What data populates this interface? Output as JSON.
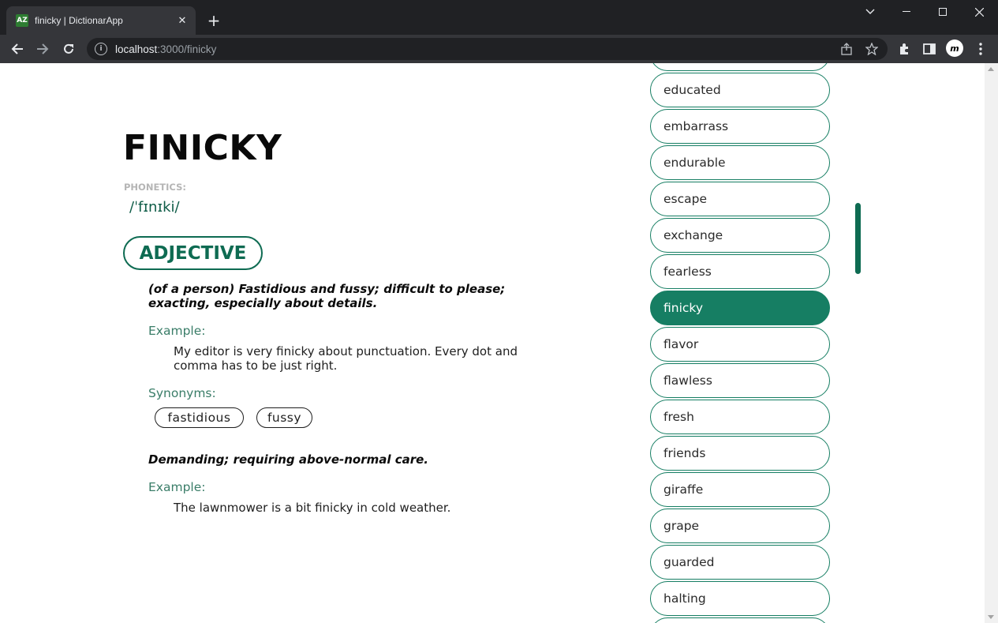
{
  "browser": {
    "tab_title": "finicky | DictionarApp",
    "favicon_text": "AZ",
    "url_host": "localhost",
    "url_path": ":3000/finicky",
    "avatar_letter": "m"
  },
  "entry": {
    "word": "FINICKY",
    "phonetics_label": "PHONETICS:",
    "phonetics": "/ˈfɪnɪki/",
    "part_of_speech": "ADJECTIVE",
    "definitions": [
      {
        "text": "(of a person) Fastidious and fussy; difficult to please; exacting, especially about details.",
        "example_label": "Example:",
        "example": "My editor is very finicky about punctuation. Every dot and comma has to be just right.",
        "synonyms_label": "Synonyms:",
        "synonyms": [
          "fastidious",
          "fussy"
        ]
      },
      {
        "text": "Demanding; requiring above-normal care.",
        "example_label": "Example:",
        "example": "The lawnmower is a bit finicky in cold weather."
      }
    ]
  },
  "word_list": {
    "items": [
      "educated",
      "embarrass",
      "endurable",
      "escape",
      "exchange",
      "fearless",
      "finicky",
      "flavor",
      "flawless",
      "fresh",
      "friends",
      "giraffe",
      "grape",
      "guarded",
      "halting"
    ],
    "active": "finicky"
  },
  "colors": {
    "accent": "#167e63",
    "accent_dark": "#0e6b52"
  }
}
